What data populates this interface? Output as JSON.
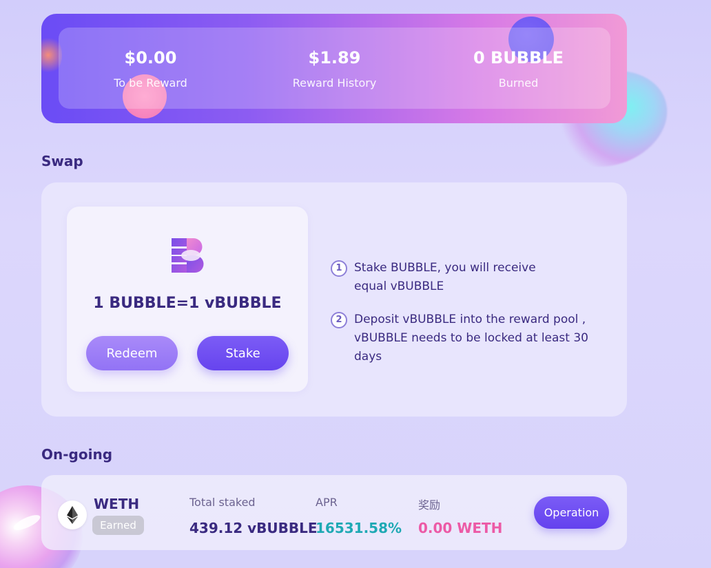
{
  "stats": [
    {
      "value": "$0.00",
      "label": "To be Reward"
    },
    {
      "value": "$1.89",
      "label": "Reward History"
    },
    {
      "value": "0 BUBBLE",
      "label": "Burned"
    }
  ],
  "swap": {
    "title": "Swap",
    "rate": "1 BUBBLE=1 vBUBBLE",
    "redeem_label": "Redeem",
    "stake_label": "Stake",
    "logo_icon": "bubble-logo-icon",
    "steps": [
      {
        "num": "1",
        "text": "Stake BUBBLE, you will receive equal vBUBBLE"
      },
      {
        "num": "2",
        "text": "Deposit vBUBBLE into the reward pool , vBUBBLE needs to be locked at least 30 days"
      }
    ]
  },
  "ongoing": {
    "title": "On-going",
    "pools": [
      {
        "token": "WETH",
        "token_icon": "ethereum-icon",
        "badge": "Earned",
        "total_staked_label": "Total staked",
        "total_staked_value": "439.12 vBUBBLE",
        "apr_label": "APR",
        "apr_value": "16531.58%",
        "reward_label": "奖励",
        "reward_value": "0.00 WETH",
        "operation_label": "Operation"
      }
    ]
  },
  "colors": {
    "accent": "#6b4cf2",
    "apr": "#1fa9b4",
    "reward": "#ec5aa6",
    "heading": "#3a2a80"
  }
}
